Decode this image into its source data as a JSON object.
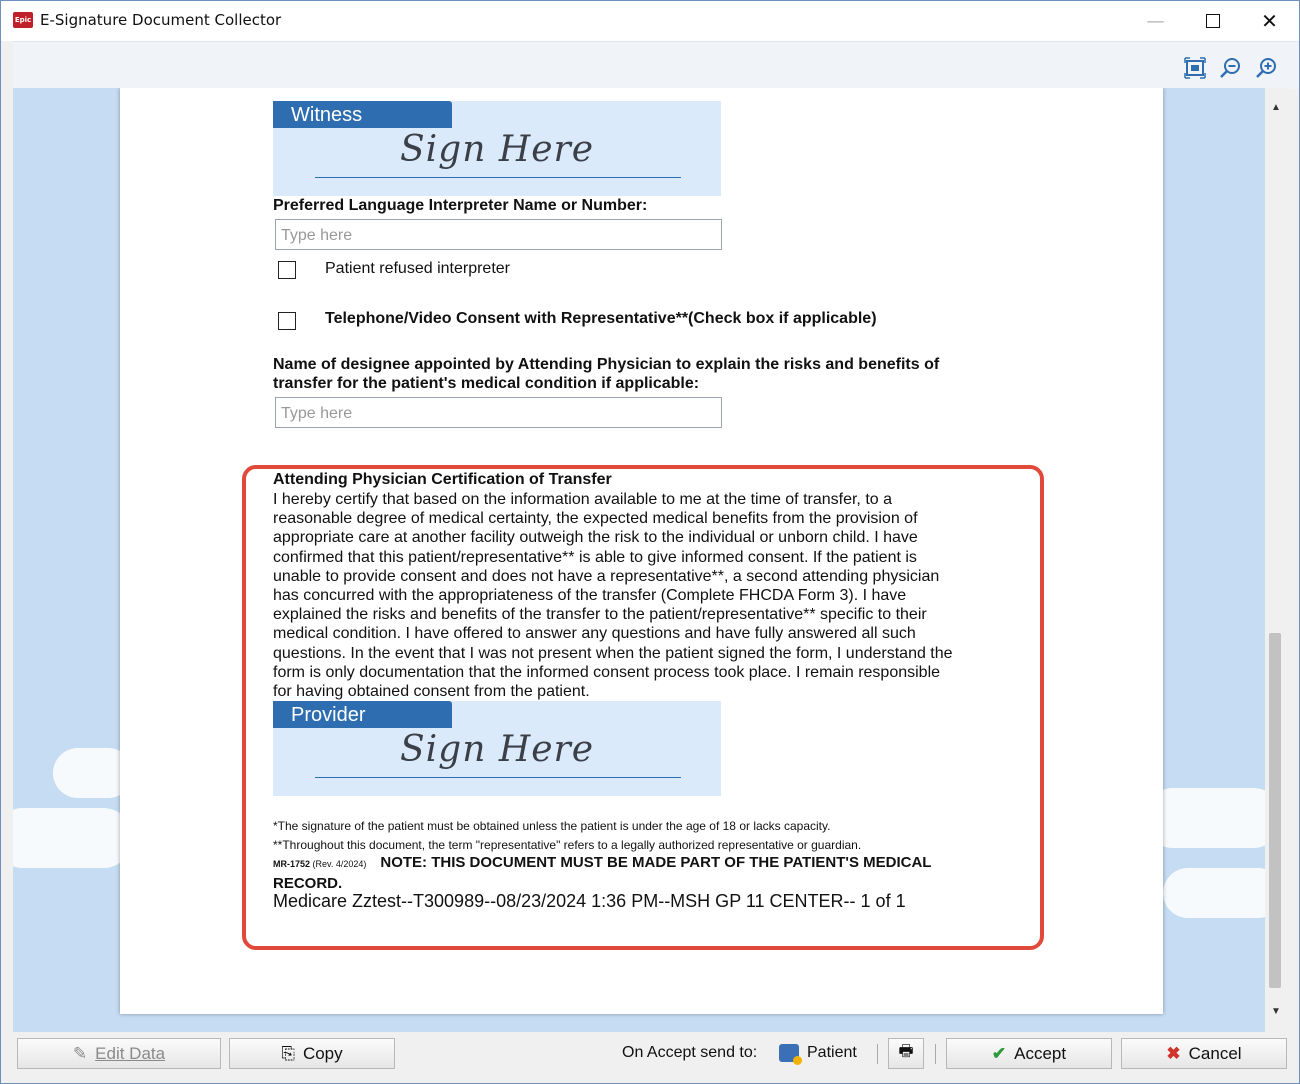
{
  "window": {
    "title": "E-Signature Document Collector",
    "app_icon_text": "Epic"
  },
  "toolbar": {
    "icons": [
      "fit-page-icon",
      "zoom-out-icon",
      "zoom-in-icon"
    ]
  },
  "document": {
    "witness": {
      "tab": "Witness",
      "sign": "Sign Here"
    },
    "interpreter_label": "Preferred Language Interpreter Name or Number:",
    "interpreter_placeholder": "Type here",
    "refused_interpreter": "Patient refused interpreter",
    "telephone_consent": "Telephone/Video Consent with Representative**(Check box if applicable)",
    "designee_label_1": "Name of designee appointed by Attending Physician to explain the risks and benefits of",
    "designee_label_2": "transfer for the patient's medical condition if applicable:",
    "designee_placeholder": "Type here",
    "cert_title": "Attending Physician Certification of Transfer",
    "cert_lines": [
      "I hereby certify that based on the information available to me at the time of  transfer, to a",
      "reasonable degree of medical certainty, the expected medical benefits from the provision of",
      "appropriate care at another facility outweigh the risk to the individual or unborn child. I have",
      "confirmed that this patient/representative** is able to give informed consent. If the patient is",
      "unable to provide consent and does not have a representative**, a second attending physician",
      "has concurred with the appropriateness of the transfer (Complete FHCDA Form 3). I have",
      "explained the risks and benefits of the transfer to the patient/representative** specific to their",
      "medical condition. I have offered to answer any questions and have fully answered all such",
      "questions. In the event that I was not present when the patient signed the form, I understand the",
      "form is only documentation that the informed consent process took place. I remain responsible",
      "for having obtained consent from the patient."
    ],
    "provider": {
      "tab": "Provider",
      "sign": "Sign Here"
    },
    "footnote_1": "*The signature of the patient must be obtained unless the patient is under the age of 18 or lacks capacity.",
    "footnote_2": "**Throughout this document, the term \"representative\" refers to a legally authorized representative or guardian.",
    "form_code": "MR-1752",
    "form_rev": "(Rev. 4/2024)",
    "note": "NOTE: THIS DOCUMENT MUST BE MADE PART OF THE PATIENT'S MEDICAL RECORD.",
    "doc_id": "Medicare Zztest--T300989--08/23/2024 1:36 PM--MSH GP 11 CENTER-- 1 of 1"
  },
  "bottom": {
    "edit_data": "Edit Data",
    "copy": "Copy",
    "send_label": "On Accept send to:",
    "send_target": "Patient",
    "accept": "Accept",
    "cancel": "Cancel"
  },
  "colors": {
    "accent": "#2e6eb0",
    "highlight": "#e14a3a",
    "sign_block": "#dbeafa",
    "viewer_bg": "#c6dcf2"
  }
}
